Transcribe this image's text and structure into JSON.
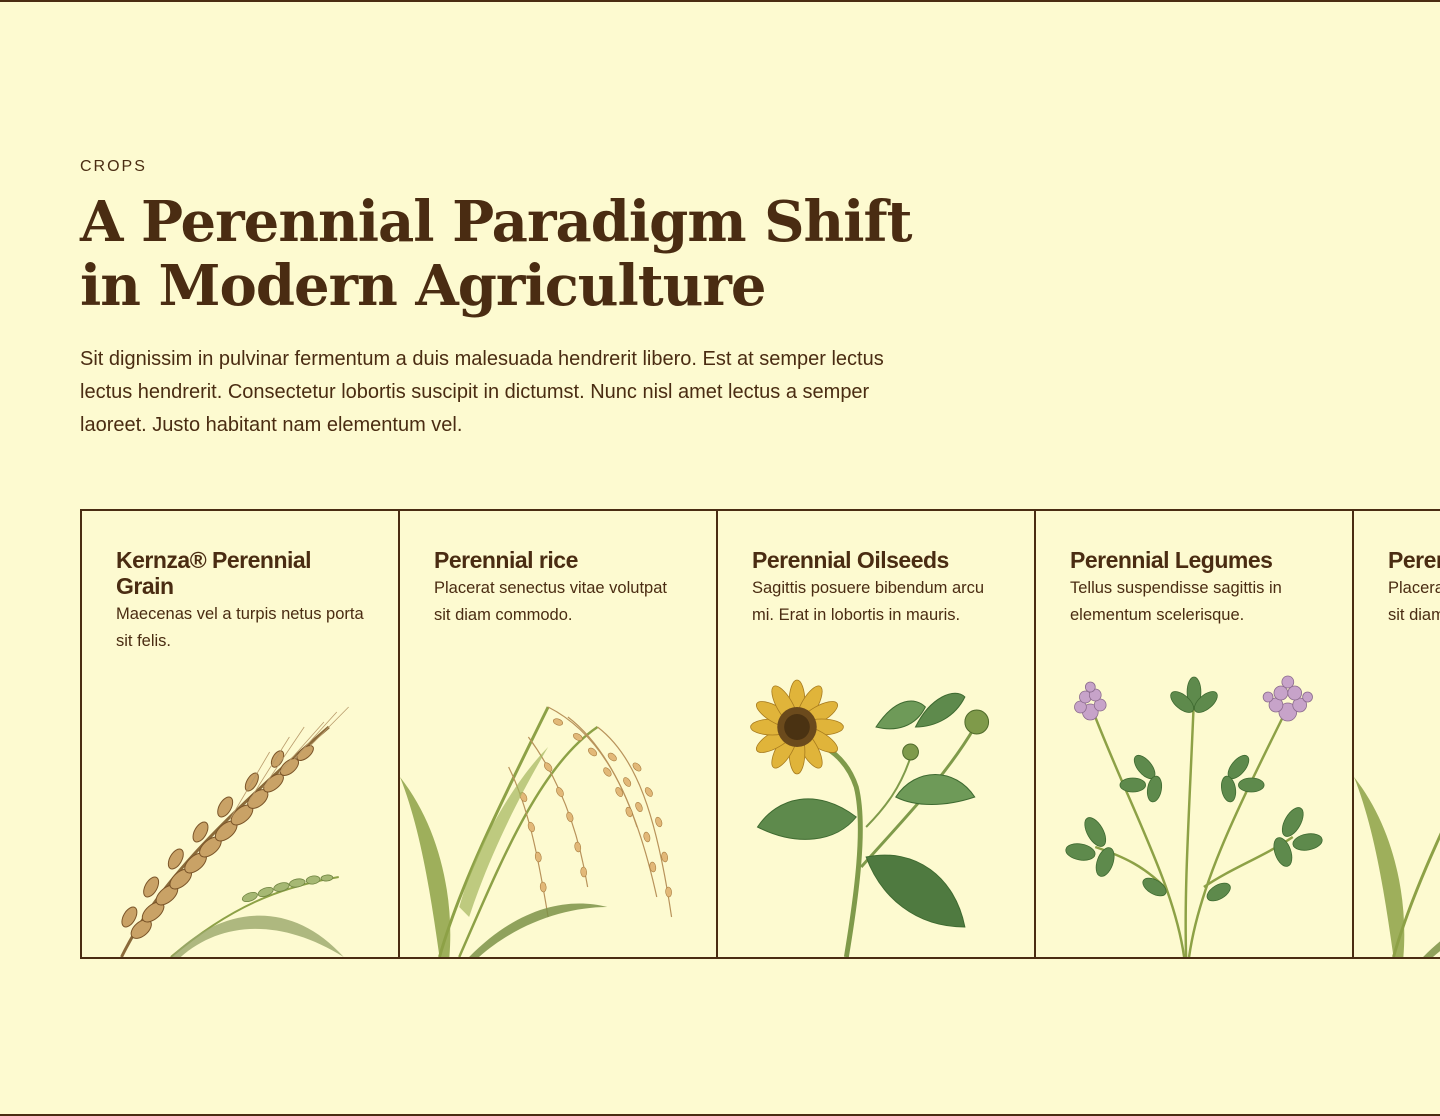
{
  "section": {
    "eyebrow": "CROPS",
    "headline": "A Perennial Paradigm Shift in Modern Agriculture",
    "lede": "Sit dignissim in pulvinar fermentum a duis malesuada hendrerit libero. Est at semper lectus lectus hendrerit. Consectetur lobortis suscipit in dictumst. Nunc nisl amet lectus a semper laoreet. Justo habitant nam elementum vel."
  },
  "cards": [
    {
      "title": "Kernza® Perennial Grain",
      "description": "Maecenas vel a turpis netus porta sit felis.",
      "illustration": "wheat-illustration"
    },
    {
      "title": "Perennial rice",
      "description": "Placerat senectus vitae volutpat sit diam commodo.",
      "illustration": "rice-illustration"
    },
    {
      "title": "Perennial Oilseeds",
      "description": "Sagittis posuere bibendum arcu mi. Erat in lobortis in mauris.",
      "illustration": "sunflower-illustration"
    },
    {
      "title": "Perennial Legumes",
      "description": "Tellus suspendisse sagittis in elementum scelerisque.",
      "illustration": "clover-illustration"
    },
    {
      "title": "Perennial rice",
      "description": "Placerat senectus vitae volutpat sit diam commodo.",
      "illustration": "rice-illustration"
    }
  ],
  "colors": {
    "background": "#fdfad0",
    "ink": "#4a2c12",
    "grain": "#c9a266",
    "stem": "#8da146",
    "leaf": "#5e8a4c",
    "petal": "#e0b43a",
    "blossom": "#c7a3c9"
  }
}
